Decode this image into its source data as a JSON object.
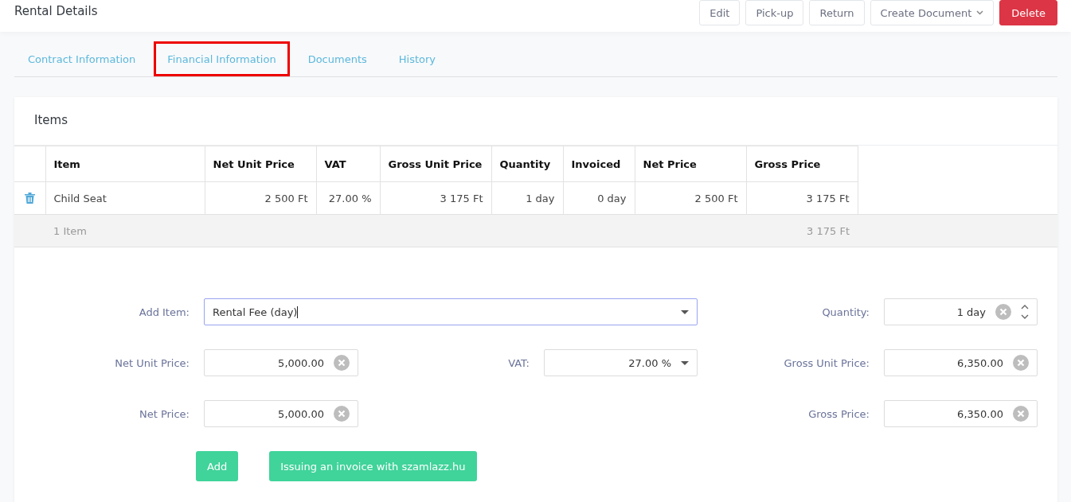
{
  "header": {
    "title": "Rental Details",
    "actions": [
      {
        "label": "Edit",
        "kind": "plain"
      },
      {
        "label": "Pick-up",
        "kind": "plain"
      },
      {
        "label": "Return",
        "kind": "plain"
      },
      {
        "label": "Create Document",
        "kind": "dropdown"
      },
      {
        "label": "Delete",
        "kind": "danger"
      }
    ]
  },
  "tabs": [
    {
      "label": "Contract Information",
      "selected": false
    },
    {
      "label": "Financial Information",
      "selected": true
    },
    {
      "label": "Documents",
      "selected": false
    },
    {
      "label": "History",
      "selected": false
    }
  ],
  "items_card": {
    "title": "Items",
    "table": {
      "columns": [
        "Item",
        "Net Unit Price",
        "VAT",
        "Gross Unit Price",
        "Quantity",
        "Invoiced",
        "Net Price",
        "Gross Price"
      ],
      "rows": [
        {
          "cells": [
            "Child Seat",
            "2 500 Ft",
            "27.00 %",
            "3 175 Ft",
            "1 day",
            "0 day",
            "2 500 Ft",
            "3 175 Ft"
          ]
        }
      ],
      "footer": {
        "count": "1 Item",
        "total": "3 175 Ft"
      }
    },
    "form": {
      "add_item": {
        "label": "Add Item:",
        "value": "Rental Fee (day)"
      },
      "quantity": {
        "label": "Quantity:",
        "value": "1 day"
      },
      "net_unit_price": {
        "label": "Net Unit Price:",
        "value": "5,000.00"
      },
      "vat": {
        "label": "VAT:",
        "value": "27.00 %"
      },
      "gross_unit_price": {
        "label": "Gross Unit Price:",
        "value": "6,350.00"
      },
      "net_price": {
        "label": "Net Price:",
        "value": "5,000.00"
      },
      "gross_price": {
        "label": "Gross Price:",
        "value": "6,350.00"
      },
      "buttons": [
        "Add",
        "Issuing an invoice with szamlazz.hu"
      ]
    }
  }
}
